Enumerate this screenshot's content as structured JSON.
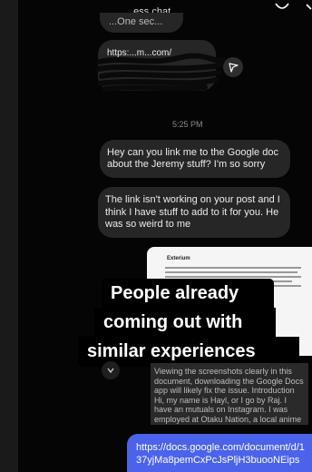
{
  "header": {
    "title": "...ess chat",
    "icon_left": "phone-icon",
    "icon_right": "video-icon"
  },
  "messages": {
    "top_partial": "...One sec...",
    "link_partial": "https:...m...com/",
    "time": "5:25 PM",
    "question_1": "Hey can you link me to the Google doc about the Jeremy stuff? I'm so sorry",
    "question_2": "The link isn't working on your post and I think I have stuff to add to it for you. He was so weird to me",
    "info_text": "Viewing the screenshots clearly in this document, downloading the Google Docs app will likely fix the issue. Introduction Hi, my name is Hayl, or I go by Raj. I have an mutuals on Instagram. I was employed at Otaku Nation, a local anime store in Tucson...",
    "url": "https://docs.google.com/document/d/137yjMa8pemCxPcJsPljH3buooNEips"
  },
  "doc_card": {
    "title": "Exterium"
  },
  "overlay": {
    "line_1": "People already",
    "line_2": "coming out with",
    "line_3": "similar experiences"
  },
  "colors": {
    "background": "#050505",
    "bubble": "#262626",
    "sent_bubble": "#4b63ea",
    "caption_bg": "#000000"
  }
}
